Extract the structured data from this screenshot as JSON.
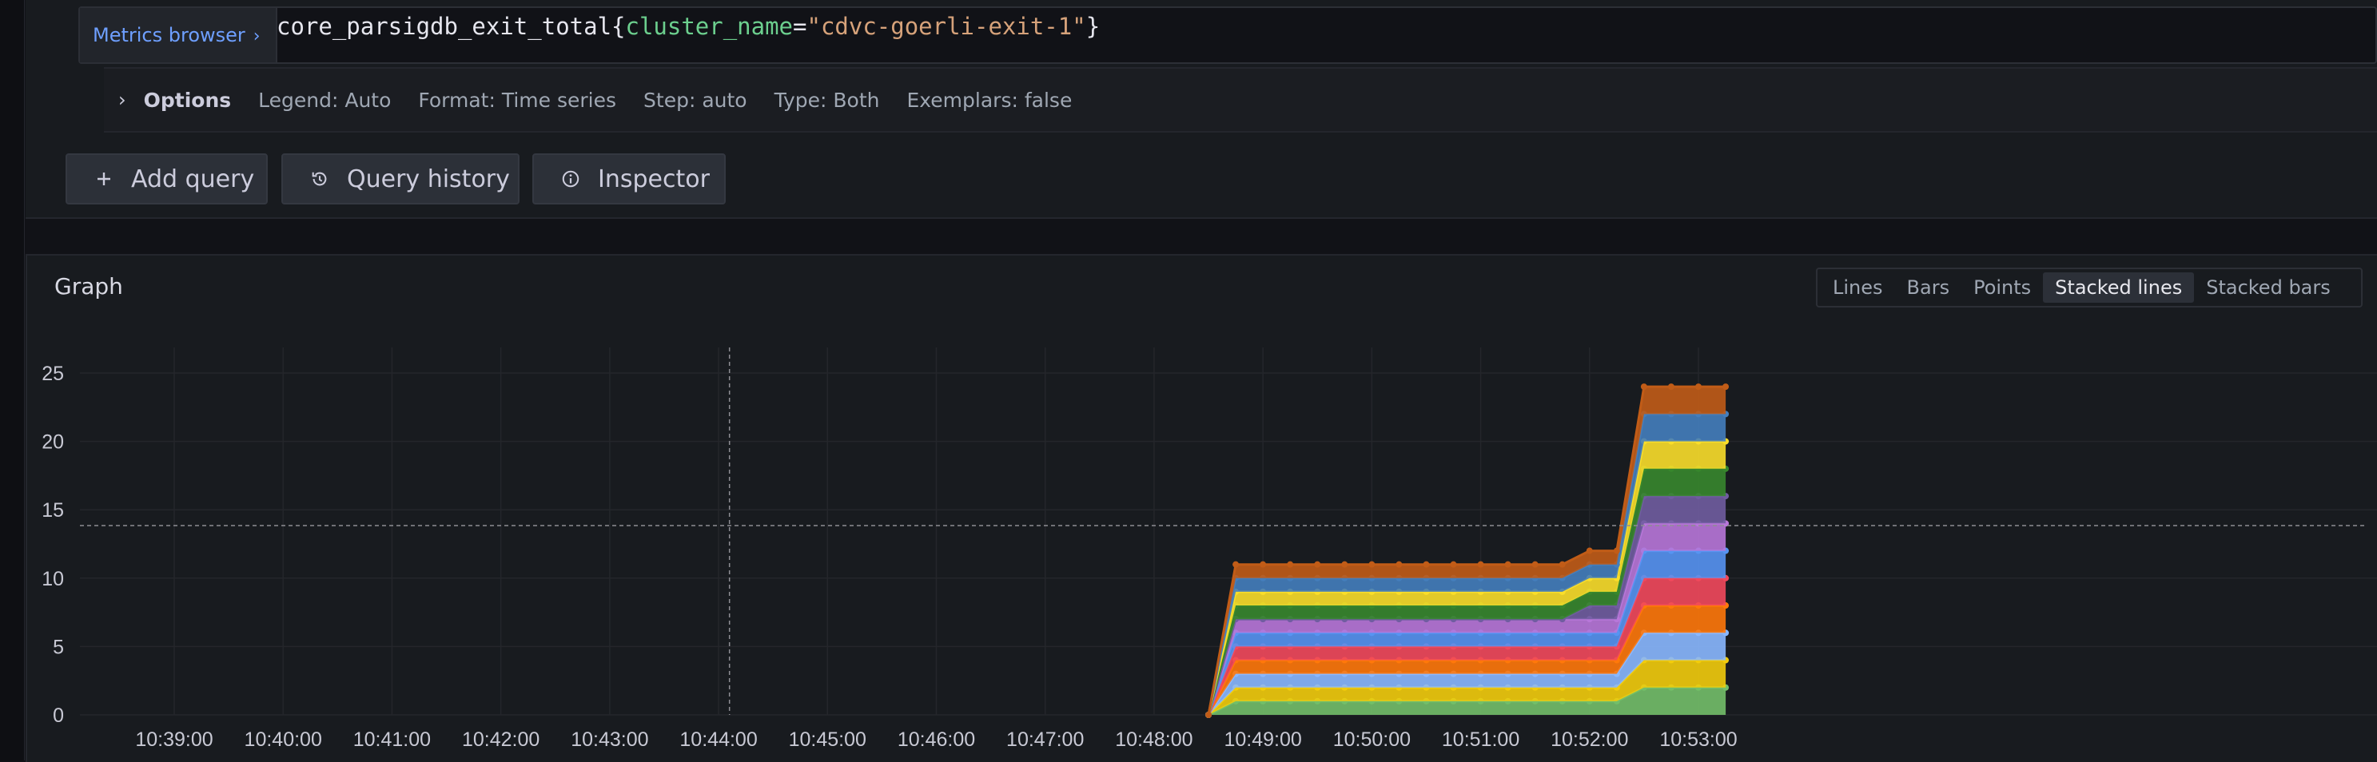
{
  "query": {
    "metrics_browser_label": "Metrics browser",
    "metric": "core_parsigdb_exit_total",
    "label_key": "cluster_name",
    "label_value": "\"cdvc-goerli-exit-1\""
  },
  "options": {
    "title": "Options",
    "items": [
      "Legend: Auto",
      "Format: Time series",
      "Step: auto",
      "Type: Both",
      "Exemplars: false"
    ]
  },
  "buttons": {
    "add_query": "Add query",
    "query_history": "Query history",
    "inspector": "Inspector"
  },
  "graph": {
    "title": "Graph",
    "modes": [
      "Lines",
      "Bars",
      "Points",
      "Stacked lines",
      "Stacked bars"
    ],
    "active_mode": "Stacked lines"
  },
  "chart_data": {
    "type": "area",
    "stacked": true,
    "x_ticks": [
      "10:39:00",
      "10:40:00",
      "10:41:00",
      "10:42:00",
      "10:43:00",
      "10:44:00",
      "10:45:00",
      "10:46:00",
      "10:47:00",
      "10:48:00",
      "10:49:00",
      "10:50:00",
      "10:51:00",
      "10:52:00",
      "10:53:00"
    ],
    "y_ticks": [
      0,
      5,
      10,
      15,
      20,
      25
    ],
    "ylim": [
      0,
      26
    ],
    "grid": true,
    "legend": "none",
    "x": [
      "10:48:30",
      "10:48:45",
      "10:49:00",
      "10:49:15",
      "10:49:30",
      "10:49:45",
      "10:50:00",
      "10:50:15",
      "10:50:30",
      "10:50:45",
      "10:51:00",
      "10:51:15",
      "10:51:30",
      "10:51:45",
      "10:52:00",
      "10:52:15",
      "10:52:30",
      "10:52:45",
      "10:53:00",
      "10:53:15"
    ],
    "series": [
      {
        "color": "#73bf69",
        "values": [
          0,
          1,
          1,
          1,
          1,
          1,
          1,
          1,
          1,
          1,
          1,
          1,
          1,
          1,
          1,
          1,
          2,
          2,
          2,
          2
        ]
      },
      {
        "color": "#f2cc0c",
        "values": [
          0,
          1,
          1,
          1,
          1,
          1,
          1,
          1,
          1,
          1,
          1,
          1,
          1,
          1,
          1,
          1,
          2,
          2,
          2,
          2
        ]
      },
      {
        "color": "#8ab8ff",
        "values": [
          0,
          1,
          1,
          1,
          1,
          1,
          1,
          1,
          1,
          1,
          1,
          1,
          1,
          1,
          1,
          1,
          2,
          2,
          2,
          2
        ]
      },
      {
        "color": "#ff780a",
        "values": [
          0,
          1,
          1,
          1,
          1,
          1,
          1,
          1,
          1,
          1,
          1,
          1,
          1,
          1,
          1,
          1,
          2,
          2,
          2,
          2
        ]
      },
      {
        "color": "#f2495c",
        "values": [
          0,
          1,
          1,
          1,
          1,
          1,
          1,
          1,
          1,
          1,
          1,
          1,
          1,
          1,
          1,
          1,
          2,
          2,
          2,
          2
        ]
      },
      {
        "color": "#5794f2",
        "values": [
          0,
          1,
          1,
          1,
          1,
          1,
          1,
          1,
          1,
          1,
          1,
          1,
          1,
          1,
          1,
          1,
          2,
          2,
          2,
          2
        ]
      },
      {
        "color": "#b877d9",
        "values": [
          0,
          1,
          1,
          1,
          1,
          1,
          1,
          1,
          1,
          1,
          1,
          1,
          1,
          1,
          1,
          1,
          2,
          2,
          2,
          2
        ]
      },
      {
        "color": "#705da0",
        "values": [
          0,
          0,
          0,
          0,
          0,
          0,
          0,
          0,
          0,
          0,
          0,
          0,
          0,
          0,
          1,
          1,
          2,
          2,
          2,
          2
        ]
      },
      {
        "color": "#37872d",
        "values": [
          0,
          1,
          1,
          1,
          1,
          1,
          1,
          1,
          1,
          1,
          1,
          1,
          1,
          1,
          1,
          1,
          2,
          2,
          2,
          2
        ]
      },
      {
        "color": "#fade2a",
        "values": [
          0,
          1,
          1,
          1,
          1,
          1,
          1,
          1,
          1,
          1,
          1,
          1,
          1,
          1,
          1,
          1,
          2,
          2,
          2,
          2
        ]
      },
      {
        "color": "#447ebc",
        "values": [
          0,
          1,
          1,
          1,
          1,
          1,
          1,
          1,
          1,
          1,
          1,
          1,
          1,
          1,
          1,
          1,
          2,
          2,
          2,
          2
        ]
      },
      {
        "color": "#c15c17",
        "values": [
          0,
          1,
          1,
          1,
          1,
          1,
          1,
          1,
          1,
          1,
          1,
          1,
          1,
          1,
          1,
          1,
          2,
          2,
          2,
          2
        ]
      }
    ]
  }
}
